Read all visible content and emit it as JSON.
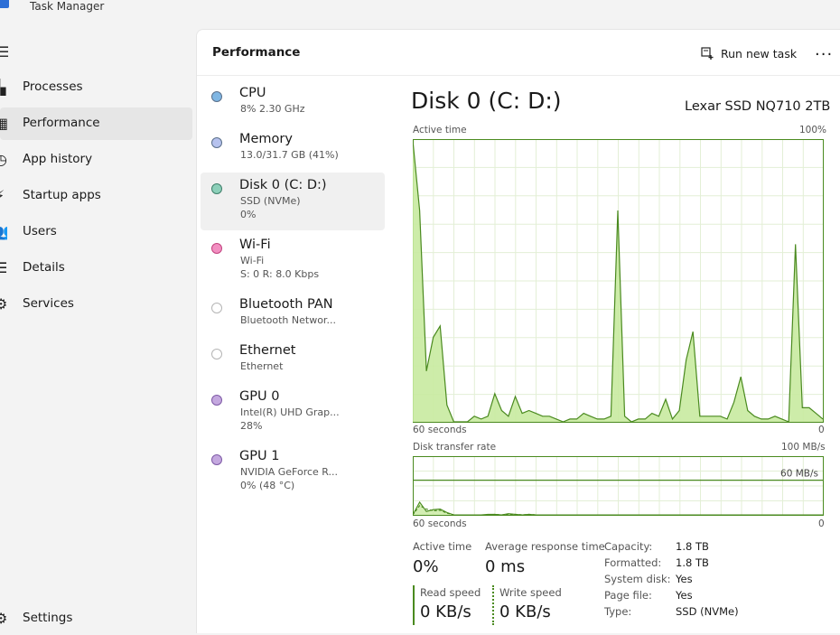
{
  "window": {
    "title": "Task Manager"
  },
  "nav": {
    "items": [
      {
        "label": "Processes",
        "icon": "processes-icon"
      },
      {
        "label": "Performance",
        "icon": "performance-icon"
      },
      {
        "label": "App history",
        "icon": "app-history-icon"
      },
      {
        "label": "Startup apps",
        "icon": "startup-apps-icon"
      },
      {
        "label": "Users",
        "icon": "users-icon"
      },
      {
        "label": "Details",
        "icon": "details-icon"
      },
      {
        "label": "Services",
        "icon": "services-icon"
      }
    ],
    "settings": "Settings",
    "active_index": 1
  },
  "header": {
    "title": "Performance",
    "run_new_task": "Run new task",
    "more": "..."
  },
  "devices": [
    {
      "name": "CPU",
      "lines": [
        "8%  2.30 GHz"
      ],
      "color": "#7fb6e3"
    },
    {
      "name": "Memory",
      "lines": [
        "13.0/31.7 GB (41%)"
      ],
      "color": "#b6c2ee"
    },
    {
      "name": "Disk 0 (C: D:)",
      "lines": [
        "SSD (NVMe)",
        "0%"
      ],
      "color": "#8ccfb9"
    },
    {
      "name": "Wi-Fi",
      "lines": [
        "Wi-Fi",
        "S: 0 R: 8.0 Kbps"
      ],
      "color": "#f28fc1"
    },
    {
      "name": "Bluetooth PAN",
      "lines": [
        "Bluetooth Networ..."
      ],
      "color": "#ffffff"
    },
    {
      "name": "Ethernet",
      "lines": [
        "Ethernet"
      ],
      "color": "#ffffff"
    },
    {
      "name": "GPU 0",
      "lines": [
        "Intel(R) UHD Grap...",
        "28%"
      ],
      "color": "#c4a8df"
    },
    {
      "name": "GPU 1",
      "lines": [
        "NVIDIA GeForce R...",
        "0%  (48 °C)"
      ],
      "color": "#c4a8df"
    }
  ],
  "active_device_index": 2,
  "disk": {
    "title": "Disk 0 (C: D:)",
    "model": "Lexar SSD NQ710 2TB",
    "active_time_chart": {
      "label": "Active time",
      "max_label": "100%",
      "x_left_label": "60 seconds",
      "x_right_label": "0",
      "line_color": "#4a8a1f",
      "fill_color": "#c8eaa0"
    },
    "transfer_chart": {
      "label": "Disk transfer rate",
      "max_label": "100 MB/s",
      "ref_line_label": "60 MB/s",
      "x_left_label": "60 seconds",
      "x_right_label": "0"
    },
    "stats": {
      "active_time_label": "Active time",
      "active_time_value": "0%",
      "avg_response_label": "Average response time",
      "avg_response_value": "0 ms",
      "read_speed_label": "Read speed",
      "read_speed_value": "0 KB/s",
      "write_speed_label": "Write speed",
      "write_speed_value": "0 KB/s"
    },
    "properties": [
      {
        "key": "Capacity:",
        "value": "1.8 TB"
      },
      {
        "key": "Formatted:",
        "value": "1.8 TB"
      },
      {
        "key": "System disk:",
        "value": "Yes"
      },
      {
        "key": "Page file:",
        "value": "Yes"
      },
      {
        "key": "Type:",
        "value": "SSD (NVMe)"
      }
    ]
  },
  "chart_data": [
    {
      "type": "area",
      "title": "Active time",
      "xlabel": "60 seconds",
      "ylim": [
        0,
        100
      ],
      "x": [
        60,
        59,
        58,
        57,
        56,
        55,
        54,
        53,
        52,
        51,
        50,
        49,
        48,
        47,
        46,
        45,
        44,
        43,
        42,
        41,
        40,
        39,
        38,
        37,
        36,
        35,
        34,
        33,
        32,
        31,
        30,
        29,
        28,
        27,
        26,
        25,
        24,
        23,
        22,
        21,
        20,
        19,
        18,
        17,
        16,
        15,
        14,
        13,
        12,
        11,
        10,
        9,
        8,
        7,
        6,
        5,
        4,
        3,
        2,
        1,
        0
      ],
      "series": [
        {
          "values": [
            100,
            75,
            18,
            30,
            34,
            6,
            0,
            0,
            0,
            2,
            1,
            2,
            10,
            4,
            2,
            9,
            3,
            4,
            3,
            2,
            2,
            1,
            0,
            1,
            1,
            3,
            2,
            1,
            1,
            2,
            75,
            2,
            0,
            1,
            1,
            3,
            2,
            8,
            1,
            4,
            22,
            32,
            2,
            2,
            2,
            2,
            1,
            7,
            16,
            4,
            2,
            1,
            1,
            2,
            1,
            0,
            63,
            5,
            5,
            3,
            1
          ]
        }
      ]
    },
    {
      "type": "line",
      "title": "Disk transfer rate",
      "xlabel": "60 seconds",
      "ylim": [
        0,
        100
      ],
      "x": [
        60,
        59,
        58,
        57,
        56,
        55,
        54,
        53,
        52,
        51,
        50,
        49,
        48,
        47,
        46,
        45,
        44,
        43,
        42,
        41,
        40,
        39,
        38,
        37,
        36,
        35,
        34,
        33,
        32,
        31,
        30,
        29,
        28,
        27,
        26,
        25,
        24,
        23,
        22,
        21,
        20,
        19,
        18,
        17,
        16,
        15,
        14,
        13,
        12,
        11,
        10,
        9,
        8,
        7,
        6,
        5,
        4,
        3,
        2,
        1,
        0
      ],
      "series": [
        {
          "values": [
            0,
            22,
            6,
            9,
            10,
            4,
            0,
            0,
            0,
            0,
            0,
            1,
            1,
            0,
            2,
            1,
            0,
            1,
            0,
            0,
            0,
            0,
            0,
            0,
            0,
            0,
            0,
            0,
            0,
            0,
            0,
            0,
            0,
            0,
            0,
            0,
            0,
            0,
            0,
            0,
            0,
            0,
            0,
            0,
            0,
            0,
            0,
            0,
            0,
            0,
            0,
            0,
            0,
            0,
            0,
            0,
            0,
            0,
            0,
            0,
            0
          ]
        },
        {
          "values": [
            0,
            16,
            10,
            7,
            8,
            3,
            0,
            0,
            0,
            0,
            0,
            0,
            1,
            0,
            1,
            1,
            0,
            1,
            0,
            0,
            0,
            0,
            0,
            0,
            0,
            0,
            0,
            0,
            0,
            0,
            0,
            0,
            0,
            0,
            0,
            0,
            0,
            0,
            0,
            0,
            0,
            0,
            0,
            0,
            0,
            0,
            0,
            0,
            0,
            0,
            0,
            0,
            0,
            0,
            0,
            0,
            0,
            0,
            0,
            0,
            0
          ]
        }
      ],
      "reference_line": 60
    }
  ]
}
